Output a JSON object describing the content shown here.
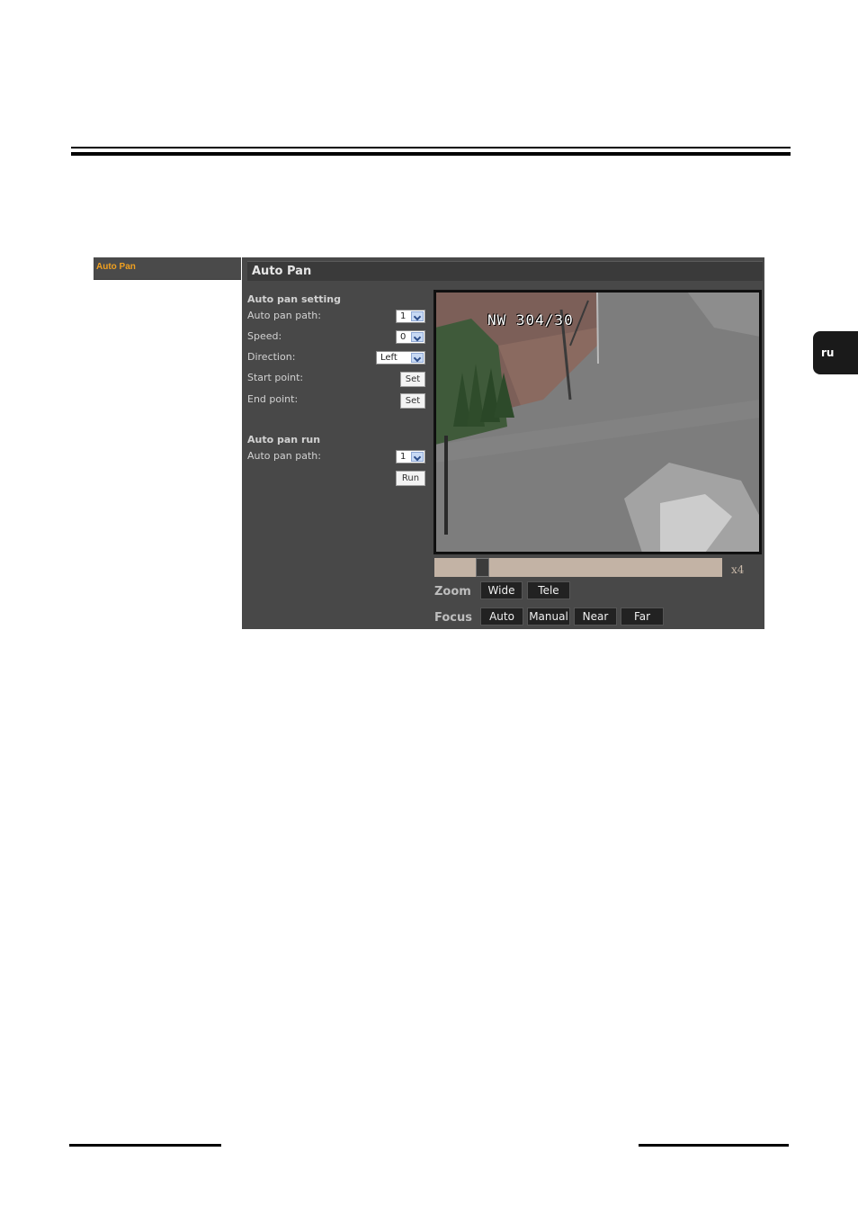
{
  "side_tab": {
    "label": "ru"
  },
  "nav": {
    "items": [
      {
        "label": "Auto Pan"
      }
    ]
  },
  "panel": {
    "title": "Auto Pan"
  },
  "auto_pan_setting": {
    "title": "Auto pan setting",
    "path_label": "Auto pan path:",
    "path_value": "1",
    "speed_label": "Speed:",
    "speed_value": "0",
    "direction_label": "Direction:",
    "direction_value": "Left",
    "start_label": "Start point:",
    "start_button": "Set",
    "end_label": "End point:",
    "end_button": "Set"
  },
  "auto_pan_run": {
    "title": "Auto pan run",
    "path_label": "Auto pan path:",
    "path_value": "1",
    "run_button": "Run"
  },
  "video": {
    "osd_text": "NW 304/30"
  },
  "zoom": {
    "label": "Zoom",
    "level": "x4",
    "slider_fraction": 0.15,
    "wide_button": "Wide",
    "tele_button": "Tele"
  },
  "focus": {
    "label": "Focus",
    "auto_button": "Auto",
    "manual_button": "Manual",
    "near_button": "Near",
    "far_button": "Far"
  },
  "colors": {
    "nav_accent": "#f0a020",
    "panel_bg": "#484848",
    "slider_track": "#c3b3a5"
  }
}
